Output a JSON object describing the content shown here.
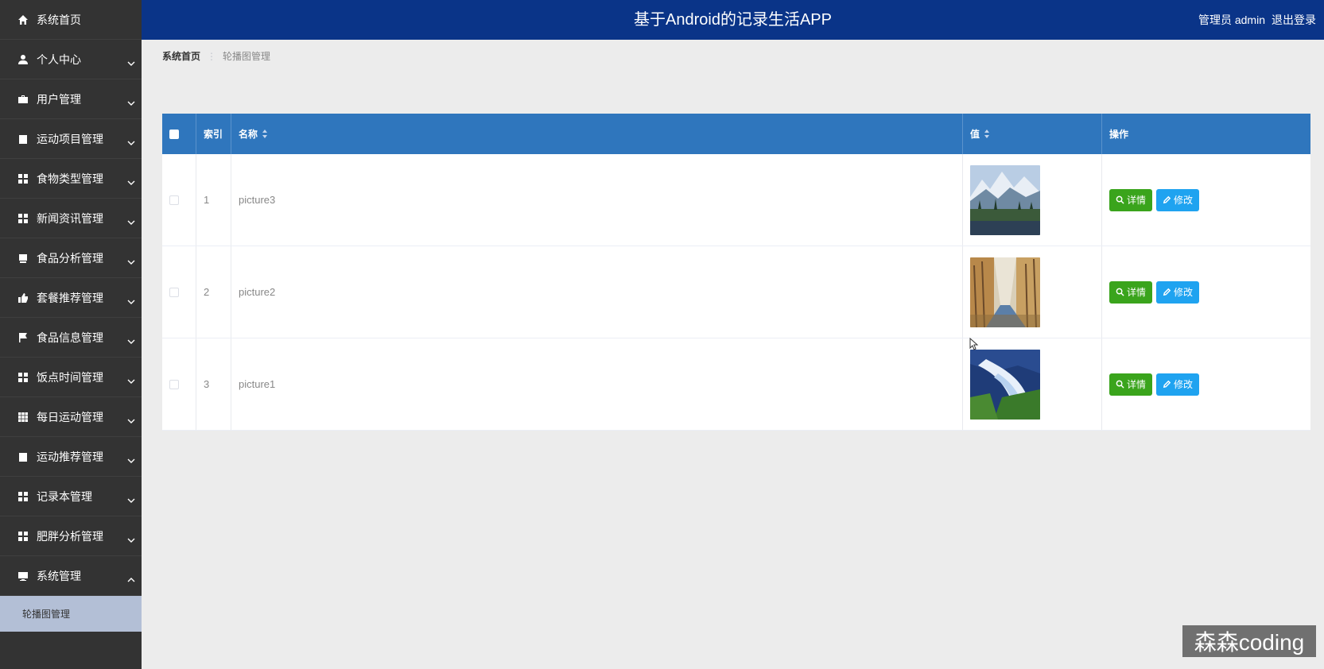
{
  "header": {
    "title": "基于Android的记录生活APP",
    "user_label": "管理员 admin",
    "logout_label": "退出登录"
  },
  "sidebar": {
    "items": [
      {
        "label": "系统首页",
        "icon": "home-icon"
      },
      {
        "label": "个人中心",
        "icon": "person-icon"
      },
      {
        "label": "用户管理",
        "icon": "briefcase-icon"
      },
      {
        "label": "运动项目管理",
        "icon": "clipboard-icon"
      },
      {
        "label": "食物类型管理",
        "icon": "grid-icon"
      },
      {
        "label": "新闻资讯管理",
        "icon": "grid-icon"
      },
      {
        "label": "食品分析管理",
        "icon": "book-icon"
      },
      {
        "label": "套餐推荐管理",
        "icon": "thumb-up-icon"
      },
      {
        "label": "食品信息管理",
        "icon": "flag-icon"
      },
      {
        "label": "饭点时间管理",
        "icon": "grid-icon"
      },
      {
        "label": "每日运动管理",
        "icon": "table-icon"
      },
      {
        "label": "运动推荐管理",
        "icon": "clipboard-icon"
      },
      {
        "label": "记录本管理",
        "icon": "grid-icon"
      },
      {
        "label": "肥胖分析管理",
        "icon": "grid-icon"
      },
      {
        "label": "系统管理",
        "icon": "monitor-icon"
      }
    ],
    "submenu": [
      {
        "label": "轮播图管理"
      }
    ]
  },
  "breadcrumb": {
    "home": "系统首页",
    "separator": "⋮",
    "current": "轮播图管理"
  },
  "table": {
    "headers": {
      "index": "索引",
      "name": "名称",
      "value": "值",
      "actions": "操作"
    },
    "rows": [
      {
        "index": "1",
        "name": "picture3",
        "image": "mountain-lake"
      },
      {
        "index": "2",
        "name": "picture2",
        "image": "autumn-forest"
      },
      {
        "index": "3",
        "name": "picture1",
        "image": "waterfall"
      }
    ],
    "detail_label": "详情",
    "edit_label": "修改"
  },
  "watermark": "森森coding",
  "colors": {
    "sidebar": "#333333",
    "header": "#0a3488",
    "table_header": "#2f76bd",
    "detail_button": "#3aa41c",
    "edit_button": "#1fa3f0",
    "active_submenu": "#b3bfd6"
  }
}
